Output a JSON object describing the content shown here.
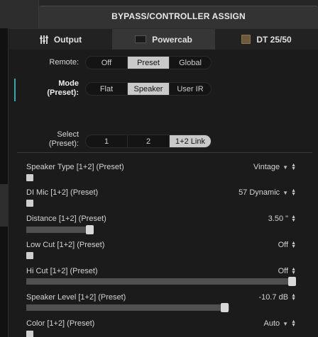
{
  "window": {
    "title": "BYPASS/CONTROLLER ASSIGN"
  },
  "tabs": [
    {
      "label": "Output",
      "icon": "sliders-icon",
      "active": false
    },
    {
      "label": "Powercab",
      "icon": "cab-icon",
      "active": true
    },
    {
      "label": "DT 25/50",
      "icon": "amp-icon",
      "active": false
    }
  ],
  "remote": {
    "label": "Remote:",
    "options": [
      "Off",
      "Preset",
      "Global"
    ],
    "selected": "Preset"
  },
  "mode": {
    "label_line1": "Mode",
    "label_line2": "(Preset):",
    "options": [
      "Flat",
      "Speaker",
      "User IR"
    ],
    "selected": "Speaker"
  },
  "select": {
    "label_line1": "Select",
    "label_line2": "(Preset):",
    "options": [
      "1",
      "2",
      "1+2 Link"
    ],
    "selected": "1+2 Link"
  },
  "params": [
    {
      "name": "Speaker Type [1+2] (Preset)",
      "value": "Vintage",
      "control": "checkbox",
      "dropdown": true
    },
    {
      "name": "DI Mic [1+2] (Preset)",
      "value": "57 Dynamic",
      "control": "checkbox",
      "dropdown": true
    },
    {
      "name": "Distance [1+2] (Preset)",
      "value": "3.50 \"",
      "control": "slider",
      "level": 0.24,
      "dropdown": false
    },
    {
      "name": "Low Cut [1+2] (Preset)",
      "value": "Off",
      "control": "checkbox",
      "dropdown": false
    },
    {
      "name": "Hi Cut [1+2] (Preset)",
      "value": "Off",
      "control": "slider",
      "level": 1.0,
      "dropdown": false
    },
    {
      "name": "Speaker Level [1+2] (Preset)",
      "value": "-10.7 dB",
      "control": "slider",
      "level": 0.75,
      "dropdown": false
    },
    {
      "name": "Color [1+2] (Preset)",
      "value": "Auto",
      "control": "checkbox",
      "dropdown": true
    }
  ],
  "colors": {
    "accent": "#3aa8ad",
    "selected_segment": "#c9c9c9",
    "background": "#1b1b1b"
  }
}
